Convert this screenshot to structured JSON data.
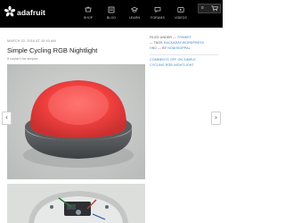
{
  "header": {
    "logo_text": "adafruit",
    "nav": [
      {
        "label": "SHOP",
        "icon": "shop-icon"
      },
      {
        "label": "BLOG",
        "icon": "blog-icon"
      },
      {
        "label": "LEARN",
        "icon": "learn-icon"
      },
      {
        "label": "FORUMS",
        "icon": "forums-icon"
      },
      {
        "label": "VIDEOS",
        "icon": "videos-icon"
      }
    ],
    "cart_count": "0",
    "cart_icon": "cart-icon"
  },
  "article": {
    "date": "MARCH 22, 2016 AT 10:40 AM",
    "title": "Simple Cycling RGB Nightlight",
    "subtitle": "It couldn't be simpler.",
    "images": [
      {
        "name": "nightlight-photo"
      },
      {
        "name": "nightlight-internals-photo"
      }
    ]
  },
  "sidebar": {
    "filed_under_label": "FILED UNDER",
    "filed_under_value": "TRINKET",
    "tags_label": "TAGS",
    "tags_value": "HACKADAY.WORDPRESS",
    "tags_value_2": "HNG",
    "by_label": "BY",
    "author": "NOAHSOPPAL",
    "comments_line_1": "COMMENTS OFF ON SIMPLE",
    "comments_line_2": "CYCLING RGB NIGHTLIGHT"
  },
  "carousel": {
    "prev_icon": "chevron-left-icon",
    "next_icon": "chevron-right-icon"
  },
  "colors": {
    "header_bg": "#000000",
    "brand_accent": "#dd3366",
    "link": "#3a84c9",
    "glow": "#ff4a4a"
  }
}
